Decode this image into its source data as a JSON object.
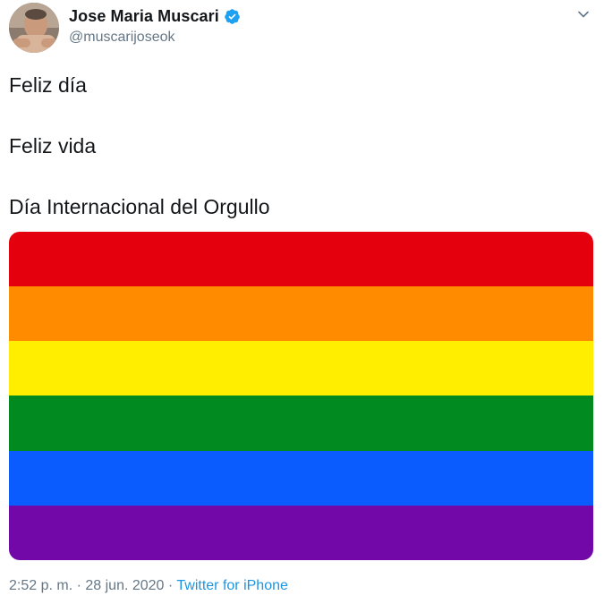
{
  "author": {
    "display_name": "Jose Maria Muscari",
    "handle": "@muscarijoseok",
    "verified": true,
    "avatar_icon": "avatar-photo"
  },
  "tweet": {
    "lines": [
      "Feliz día",
      "Feliz vida",
      "Día Internacional del Orgullo"
    ]
  },
  "media": {
    "type": "rainbow-flag",
    "stripes": [
      "#e5000e",
      "#ff8c00",
      "#ffee00",
      "#008a1f",
      "#0a5cff",
      "#7208a8"
    ]
  },
  "meta": {
    "time": "2:52 p. m.",
    "separator": " · ",
    "date": "28 jun. 2020",
    "source": "Twitter for iPhone"
  },
  "colors": {
    "link": "#1b95e0",
    "verified": "#1da1f2",
    "secondary_text": "#657786"
  },
  "icons": {
    "verified": "verified-badge-icon",
    "menu": "chevron-down-icon"
  }
}
